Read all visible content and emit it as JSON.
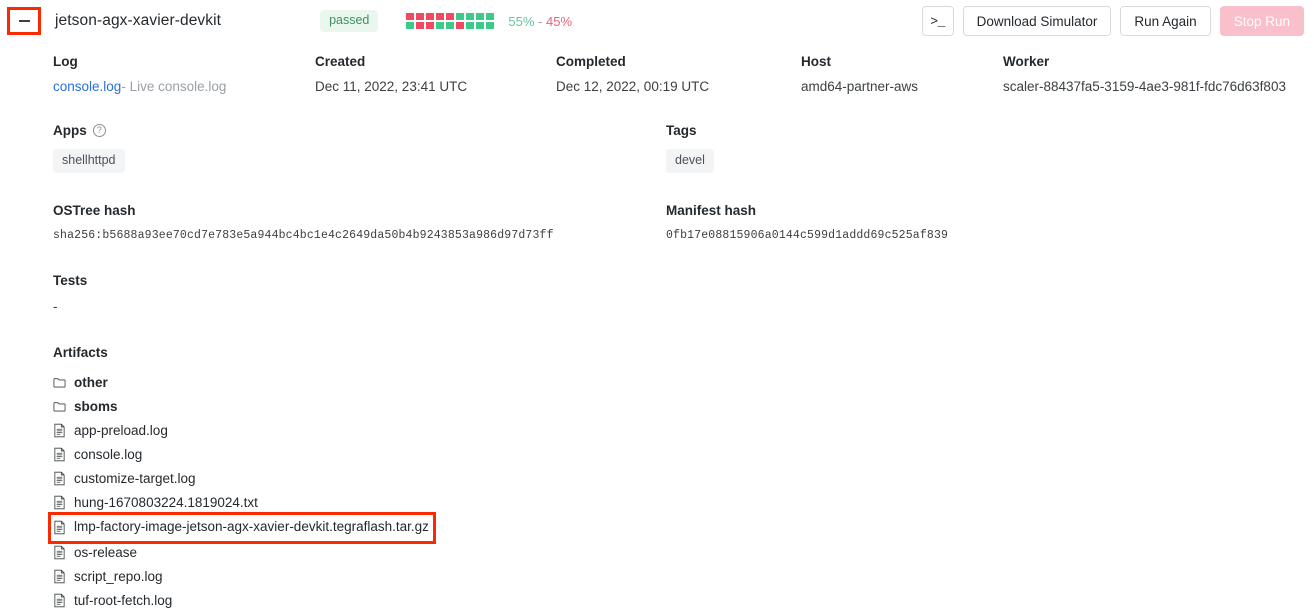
{
  "header": {
    "collapse_icon": "minus-icon",
    "title": "jetson-agx-xavier-devkit",
    "status": "passed",
    "pass_pct": "55%",
    "separator": "-",
    "fail_pct": "45%",
    "grid": {
      "rows": [
        [
          "red",
          "red",
          "red",
          "red",
          "red",
          "green",
          "green",
          "green",
          "green"
        ],
        [
          "green",
          "red",
          "red",
          "green",
          "green",
          "red",
          "green",
          "green",
          "green"
        ]
      ],
      "red_color": "#ef4a62",
      "green_color": "#3cc98b"
    },
    "terminal_button": ">_",
    "download_simulator_button": "Download Simulator",
    "run_again_button": "Run Again",
    "stop_run_button": "Stop Run"
  },
  "meta": {
    "log": {
      "label": "Log",
      "link_text": "console.log",
      "dash": "-",
      "live_text": "Live console.log"
    },
    "created": {
      "label": "Created",
      "value": "Dec 11, 2022, 23:41 UTC"
    },
    "completed": {
      "label": "Completed",
      "value": "Dec 12, 2022, 00:19 UTC"
    },
    "host": {
      "label": "Host",
      "value": "amd64-partner-aws"
    },
    "worker": {
      "label": "Worker",
      "value": "scaler-88437fa5-3159-4ae3-981f-fdc76d63f803"
    }
  },
  "apps": {
    "label": "Apps",
    "help_icon": "question-mark-icon",
    "chips": [
      "shellhttpd"
    ]
  },
  "tags": {
    "label": "Tags",
    "chips": [
      "devel"
    ]
  },
  "ostree": {
    "label": "OSTree hash",
    "value": "sha256:b5688a93ee70cd7e783e5a944bc4bc1e4c2649da50b4b9243853a986d97d73ff"
  },
  "manifest": {
    "label": "Manifest hash",
    "value": "0fb17e08815906a0144c599d1addd69c525af839"
  },
  "tests": {
    "label": "Tests",
    "value": "-"
  },
  "artifacts": {
    "label": "Artifacts",
    "items": [
      {
        "name": "other",
        "type": "folder",
        "icon": "folder-icon",
        "highlighted": false
      },
      {
        "name": "sboms",
        "type": "folder",
        "icon": "folder-icon",
        "highlighted": false
      },
      {
        "name": "app-preload.log",
        "type": "file",
        "icon": "file-icon",
        "highlighted": false
      },
      {
        "name": "console.log",
        "type": "file",
        "icon": "file-icon",
        "highlighted": false
      },
      {
        "name": "customize-target.log",
        "type": "file",
        "icon": "file-icon",
        "highlighted": false
      },
      {
        "name": "hung-1670803224.1819024.txt",
        "type": "file",
        "icon": "file-icon",
        "highlighted": false
      },
      {
        "name": "lmp-factory-image-jetson-agx-xavier-devkit.tegraflash.tar.gz",
        "type": "file",
        "icon": "file-icon",
        "highlighted": true
      },
      {
        "name": "os-release",
        "type": "file",
        "icon": "file-icon",
        "highlighted": false
      },
      {
        "name": "script_repo.log",
        "type": "file",
        "icon": "file-icon",
        "highlighted": false
      },
      {
        "name": "tuf-root-fetch.log",
        "type": "file",
        "icon": "file-icon",
        "highlighted": false
      }
    ]
  },
  "colors": {
    "highlight": "#fa2a00",
    "link": "#2b6fe0",
    "badge_bg": "#eaf7ef",
    "badge_text": "#3f8f5e",
    "danger_btn": "#f9bfcb"
  }
}
